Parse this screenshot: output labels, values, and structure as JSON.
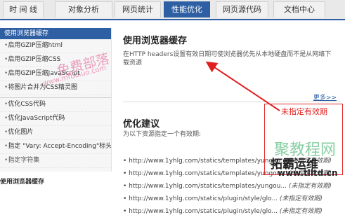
{
  "tabs": [
    {
      "label": "时 间 线"
    },
    {
      "label": "对象分析"
    },
    {
      "label": "网页统计"
    },
    {
      "label": "性能优化"
    },
    {
      "label": "网页源代码"
    },
    {
      "label": "文档中心"
    }
  ],
  "sidebar": {
    "header": "使用浏览器缓存",
    "items": [
      {
        "label": "启用GZIP压缩html"
      },
      {
        "label": "启用GZIP压缩CSS"
      },
      {
        "label": "启用GZIP压缩JavaScript"
      },
      {
        "label": "将图片合并为CSS精灵图"
      },
      {
        "label": "优化CSS代码"
      },
      {
        "label": "优化JavaScript代码"
      },
      {
        "label": "优化图片"
      },
      {
        "label": "指定 \"Vary: Accept-Encoding\"标头"
      },
      {
        "label": "指定字符集"
      }
    ]
  },
  "main": {
    "title": "使用浏览器缓存",
    "description": "在HTTP headers设置有效日期可使浏览器优先从本地硬盘而不是从网络下载资源",
    "more": "更多>>",
    "subtitle": "优化建议",
    "subdesc": "为以下资源指定一个有效期:",
    "resources": [
      {
        "url": "• http://www.1yhlg.com/statics/templates/yungou...",
        "note": "(未指定有效期)"
      },
      {
        "url": "• http://www.1yhlg.com/statics/templates/yungou...",
        "note": "(未指定有效期)"
      },
      {
        "url": "• http://www.1yhlg.com/statics/templates/yungou...",
        "note": "(未指定有效期)"
      },
      {
        "url": "• http://www.1yhlg.com/statics/plugin/style/glo...",
        "note": "(未指定有效期)"
      },
      {
        "url": "• http://www.1yhlg.com/statics/plugin/style/glo...",
        "note": "(未指定有效期)"
      }
    ]
  },
  "annotation": {
    "text": "未指定有效期"
  },
  "watermarks": {
    "mb_title": "免费部落",
    "mb_url": "www.mfbuluo.com",
    "jc_title": "聚教程网",
    "tl_title": "拓霸运维",
    "tl_url": "www.tlltd.cn"
  },
  "caption": "使用浏览器缓存"
}
